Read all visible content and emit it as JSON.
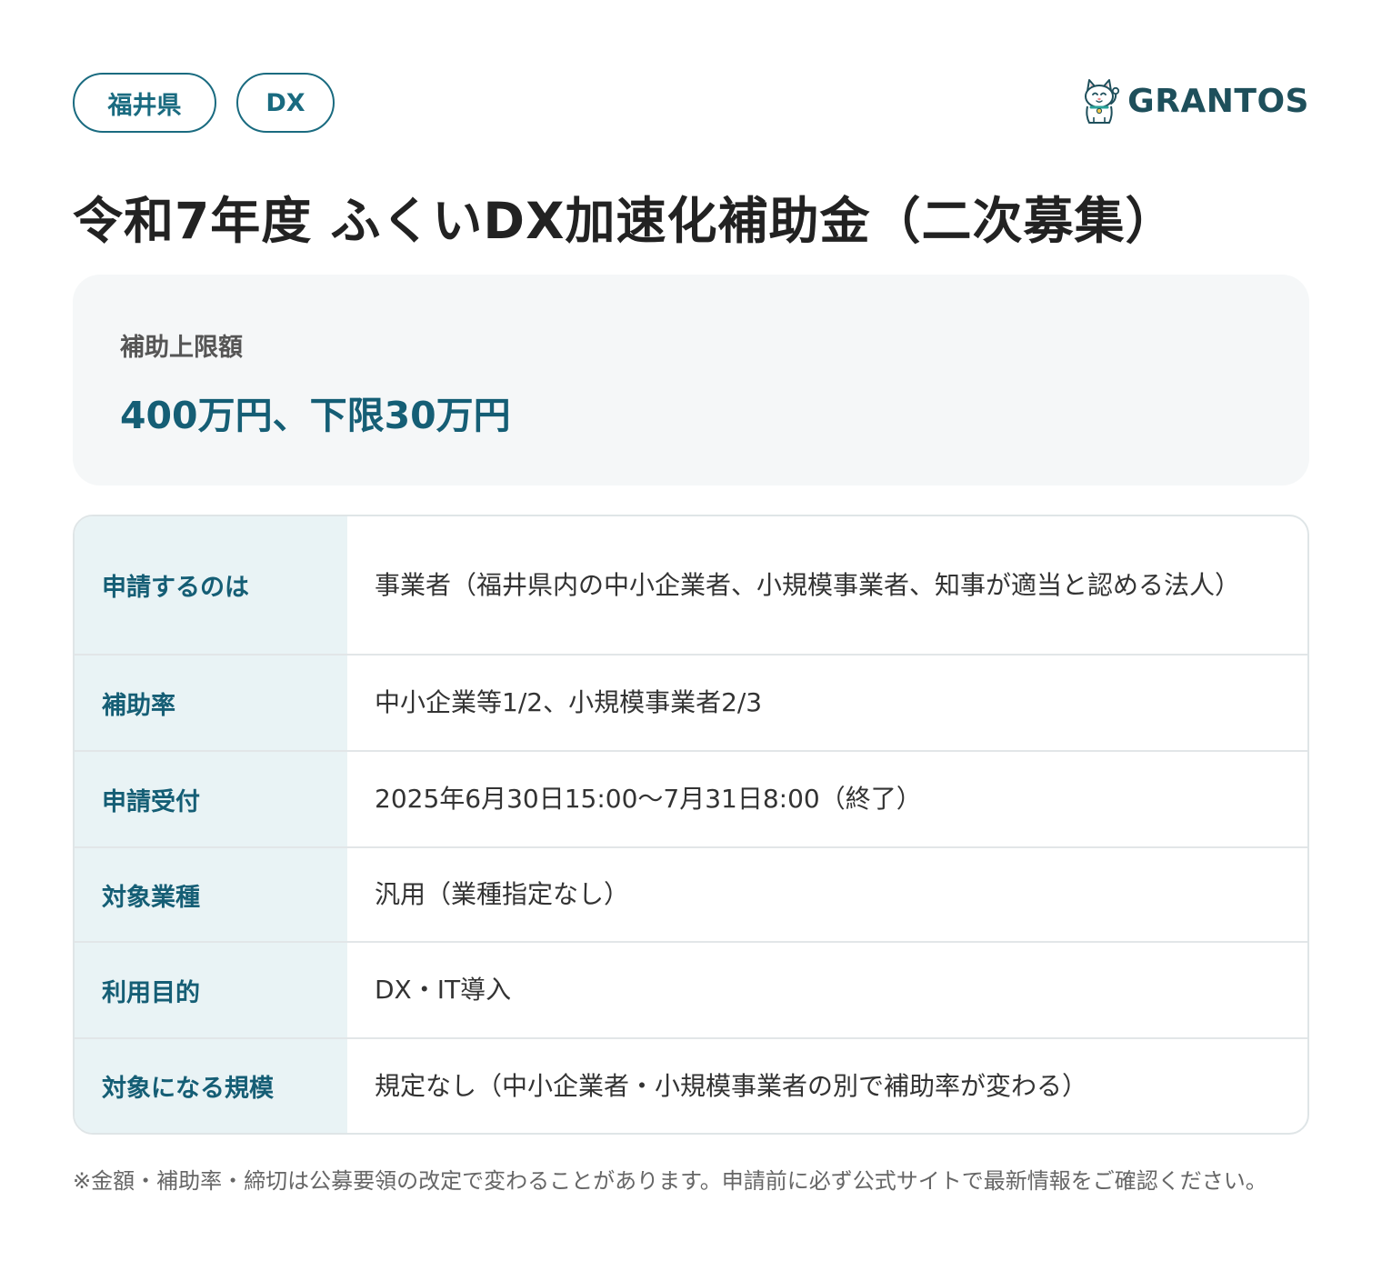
{
  "tags": [
    "福井県",
    "DX"
  ],
  "brand": {
    "name": "GRANTOS",
    "logo_icon": "maneki-neko-cat-icon"
  },
  "title": "令和7年度 ふくいDX加速化補助金（二次募集）",
  "amount": {
    "label": "補助上限額",
    "value": "400万円、下限30万円"
  },
  "rows": [
    {
      "label": "申請するのは",
      "value": "事業者（福井県内の中小企業者、小規模事業者、知事が適当と認める法人）"
    },
    {
      "label": "補助率",
      "value": "中小企業等1/2、小規模事業者2/3"
    },
    {
      "label": "申請受付",
      "value": "2025年6月30日15:00〜7月31日8:00（終了）"
    },
    {
      "label": "対象業種",
      "value": "汎用（業種指定なし）"
    },
    {
      "label": "利用目的",
      "value": "DX・IT導入"
    },
    {
      "label": "対象になる規模",
      "value": "規定なし（中小企業者・小規模事業者の別で補助率が変わる）"
    }
  ],
  "note": "※金額・補助率・締切は公募要領の改定で変わることがあります。申請前に必ず公式サイトで最新情報をご確認ください。",
  "colors": {
    "accent": "#155e75",
    "tag_border": "#1a6b80",
    "label_bg": "#e9f3f5",
    "amount_bg": "#f5f7f8",
    "brand": "#1e4f5b"
  }
}
